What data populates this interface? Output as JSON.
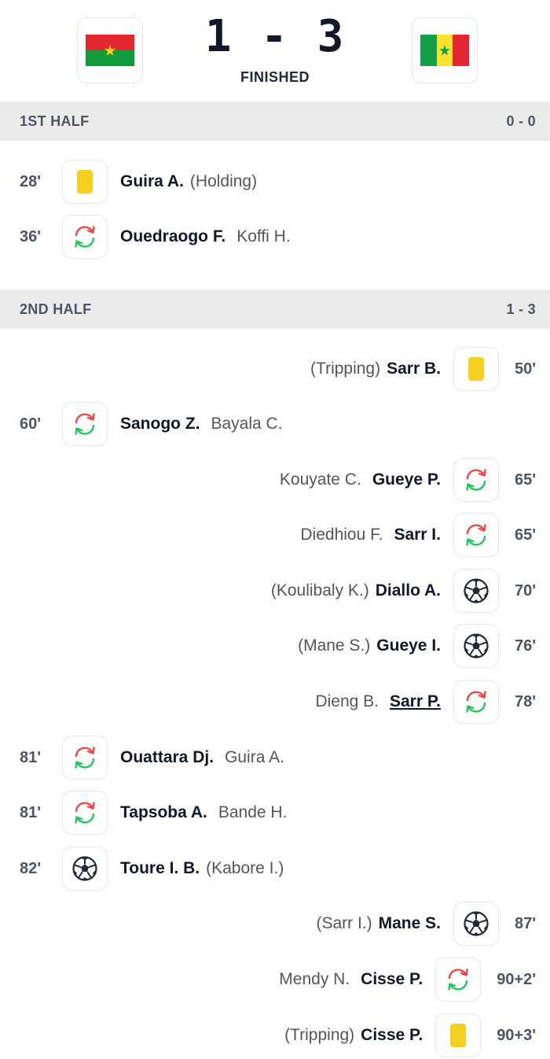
{
  "match": {
    "score": "1 - 3",
    "status": "FINISHED",
    "home_flag": "burkina-faso-flag",
    "away_flag": "senegal-flag"
  },
  "first_half": {
    "label": "1ST HALF",
    "score": "0 - 0"
  },
  "second_half": {
    "label": "2ND HALF",
    "score": "1 - 3"
  },
  "events": [
    {
      "minute": "28'",
      "side": "home",
      "icon": "yellow-card-icon",
      "player": "Guira A.",
      "secondary": "(Holding)"
    },
    {
      "minute": "36'",
      "side": "home",
      "icon": "substitution-icon",
      "player": "Ouedraogo F.",
      "secondary": "Koffi H."
    },
    {
      "minute": "50'",
      "side": "away",
      "icon": "yellow-card-icon",
      "player": "Sarr B.",
      "secondary": "(Tripping)"
    },
    {
      "minute": "60'",
      "side": "home",
      "icon": "substitution-icon",
      "player": "Sanogo Z.",
      "secondary": "Bayala C."
    },
    {
      "minute": "65'",
      "side": "away",
      "icon": "substitution-icon",
      "player": "Gueye P.",
      "secondary": "Kouyate C."
    },
    {
      "minute": "65'",
      "side": "away",
      "icon": "substitution-icon",
      "player": "Sarr I.",
      "secondary": "Diedhiou F."
    },
    {
      "minute": "70'",
      "side": "away",
      "icon": "goal-ball-icon",
      "player": "Diallo A.",
      "secondary": "(Koulibaly K.)"
    },
    {
      "minute": "76'",
      "side": "away",
      "icon": "goal-ball-icon",
      "player": "Gueye I.",
      "secondary": "(Mane S.)"
    },
    {
      "minute": "78'",
      "side": "away",
      "icon": "substitution-icon",
      "player": "Sarr P.",
      "secondary": "Dieng B."
    },
    {
      "minute": "81'",
      "side": "home",
      "icon": "substitution-icon",
      "player": "Ouattara Dj.",
      "secondary": "Guira A."
    },
    {
      "minute": "81'",
      "side": "home",
      "icon": "substitution-icon",
      "player": "Tapsoba A.",
      "secondary": "Bande H."
    },
    {
      "minute": "82'",
      "side": "home",
      "icon": "goal-ball-icon",
      "player": "Toure I. B.",
      "secondary": "(Kabore I.)"
    },
    {
      "minute": "87'",
      "side": "away",
      "icon": "goal-ball-icon",
      "player": "Mane S.",
      "secondary": "(Sarr I.)"
    },
    {
      "minute": "90+2'",
      "side": "away",
      "icon": "substitution-icon",
      "player": "Cisse P.",
      "secondary": "Mendy N."
    },
    {
      "minute": "90+3'",
      "side": "away",
      "icon": "yellow-card-icon",
      "player": "Cisse P.",
      "secondary": "(Tripping)"
    }
  ],
  "colors": {
    "yellow_card": "#f4d01f",
    "sub_in": "#22c55e",
    "sub_out": "#ef4444",
    "half_bar_bg": "#ebebeb"
  }
}
